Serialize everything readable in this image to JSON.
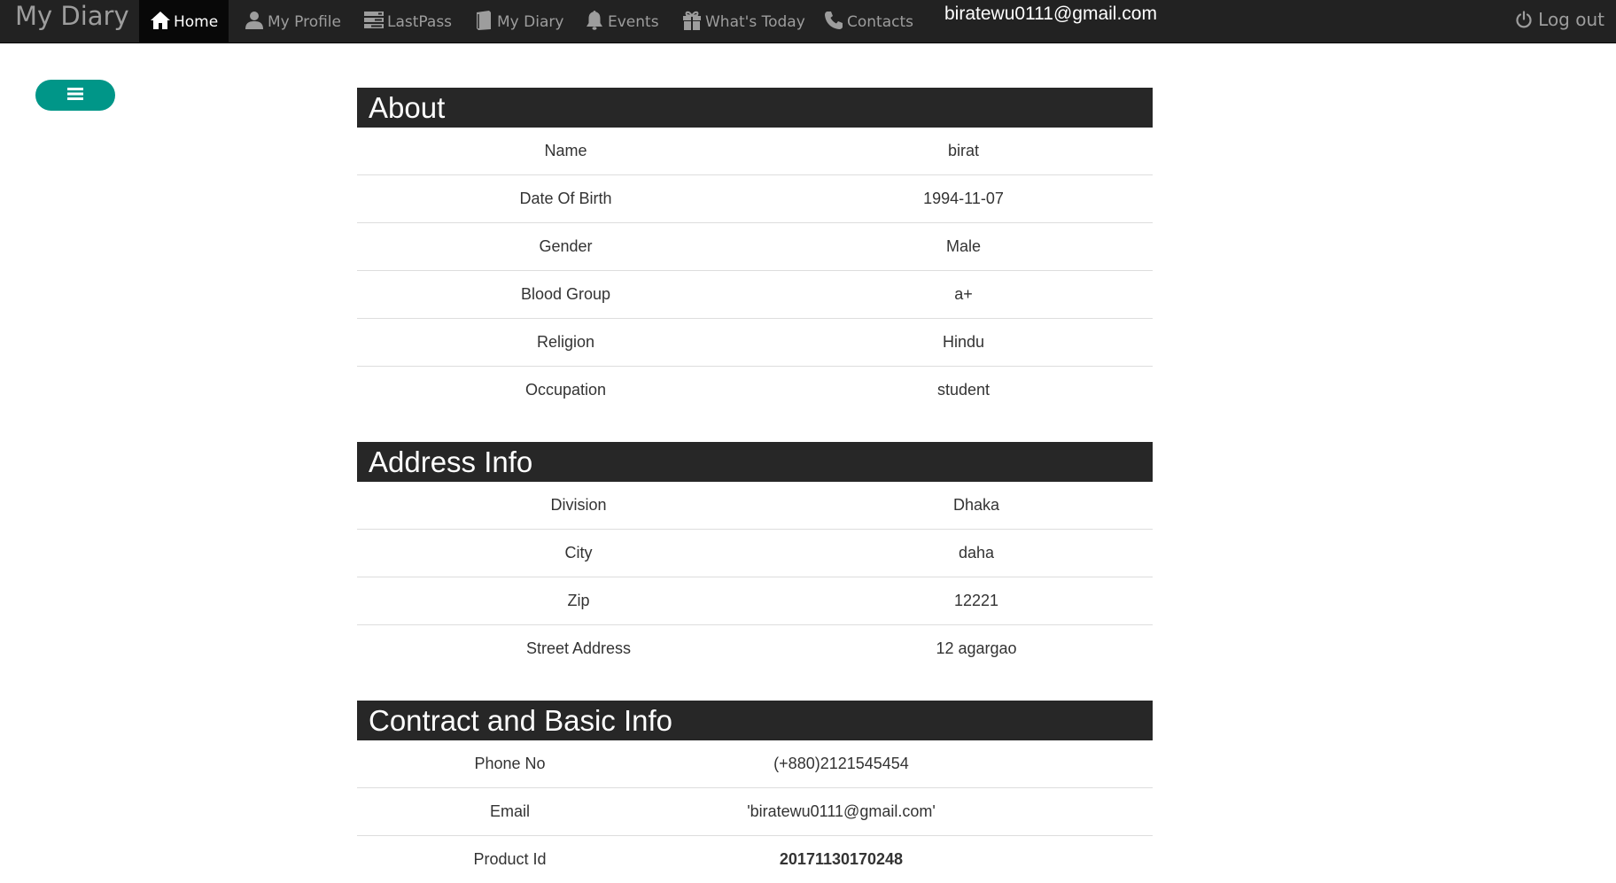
{
  "navbar": {
    "brand": "My Diary",
    "items": [
      {
        "label": "Home",
        "icon": "home-icon"
      },
      {
        "label": "My Profile",
        "icon": "user-icon"
      },
      {
        "label": "LastPass",
        "icon": "tasks-icon"
      },
      {
        "label": "My Diary",
        "icon": "book-icon"
      },
      {
        "label": "Events",
        "icon": "bell-icon"
      },
      {
        "label": "What's Today",
        "icon": "gift-icon"
      },
      {
        "label": "Contacts",
        "icon": "phone-icon"
      }
    ],
    "user_email": "biratewu0111@gmail.com",
    "logout_label": "Log out"
  },
  "colors": {
    "navbar_bg": "#222222",
    "active_bg": "#080808",
    "toggle_accent": "#009688",
    "section_header_bg": "#272727"
  },
  "sections": {
    "about": {
      "title": "About",
      "rows": [
        {
          "key": "Name",
          "value": "birat"
        },
        {
          "key": "Date Of Birth",
          "value": "1994-11-07"
        },
        {
          "key": "Gender",
          "value": "Male"
        },
        {
          "key": "Blood Group",
          "value": "a+"
        },
        {
          "key": "Religion",
          "value": "Hindu"
        },
        {
          "key": "Occupation",
          "value": "student"
        }
      ]
    },
    "address": {
      "title": "Address Info",
      "rows": [
        {
          "key": "Division",
          "value": "Dhaka"
        },
        {
          "key": "City",
          "value": "daha"
        },
        {
          "key": "Zip",
          "value": "12221"
        },
        {
          "key": "Street Address",
          "value": "12 agargao"
        }
      ]
    },
    "contact": {
      "title": "Contract and Basic Info",
      "rows": [
        {
          "key": "Phone No",
          "value": "(+880)2121545454"
        },
        {
          "key": "Email",
          "value": "'biratewu0111@gmail.com'"
        },
        {
          "key": "Product Id",
          "value": "20171130170248"
        }
      ]
    }
  }
}
